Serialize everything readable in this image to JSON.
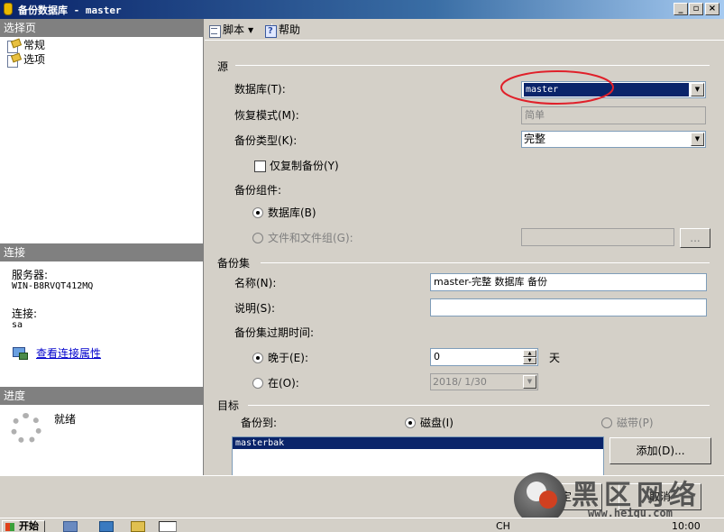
{
  "window": {
    "title": "备份数据库 - master"
  },
  "left": {
    "select_page_header": "选择页",
    "pages": [
      {
        "label": "常规"
      },
      {
        "label": "选项"
      }
    ],
    "connection_header": "连接",
    "server_label": "服务器:",
    "server_value": "WIN-B8RVQT412MQ",
    "connection_label": "连接:",
    "connection_value": "sa",
    "view_properties_link": "查看连接属性",
    "progress_header": "进度",
    "progress_status": "就绪"
  },
  "toolbar": {
    "script_label": "脚本",
    "help_label": "帮助"
  },
  "source": {
    "section_label": "源",
    "database_label": "数据库(T):",
    "database_value": "master",
    "recovery_label": "恢复模式(M):",
    "recovery_value": "简单",
    "backup_type_label": "备份类型(K):",
    "backup_type_value": "完整",
    "copy_only_label": "仅复制备份(Y)",
    "copy_only_checked": false,
    "component_label": "备份组件:",
    "component_database_label": "数据库(B)",
    "component_files_label": "文件和文件组(G):",
    "component_files_button": "...",
    "component_selected": "database"
  },
  "backup_set": {
    "section_label": "备份集",
    "name_label": "名称(N):",
    "name_value": "master-完整 数据库 备份",
    "description_label": "说明(S):",
    "description_value": "",
    "expire_label": "备份集过期时间:",
    "after_label": "晚于(E):",
    "after_value": "0",
    "after_unit": "天",
    "on_label": "在(O):",
    "on_value": "2018/ 1/30",
    "expire_selected": "after"
  },
  "destination": {
    "section_label": "目标",
    "backup_to_label": "备份到:",
    "disk_label": "磁盘(I)",
    "tape_label": "磁带(P)",
    "selected": "disk",
    "files": [
      "masterbak"
    ],
    "add_button": "添加(D)..."
  },
  "footer": {
    "ok_button": "确定",
    "cancel_button": "取消"
  },
  "watermark": {
    "text": "黑区网络",
    "url": "www.heiqu.com"
  },
  "taskbar": {
    "start_label": "开始",
    "lang": "CH",
    "clock": "10:00"
  },
  "colors": {
    "selection": "#0a246a",
    "annotation": "#e0202a",
    "link": "#0000cc"
  }
}
